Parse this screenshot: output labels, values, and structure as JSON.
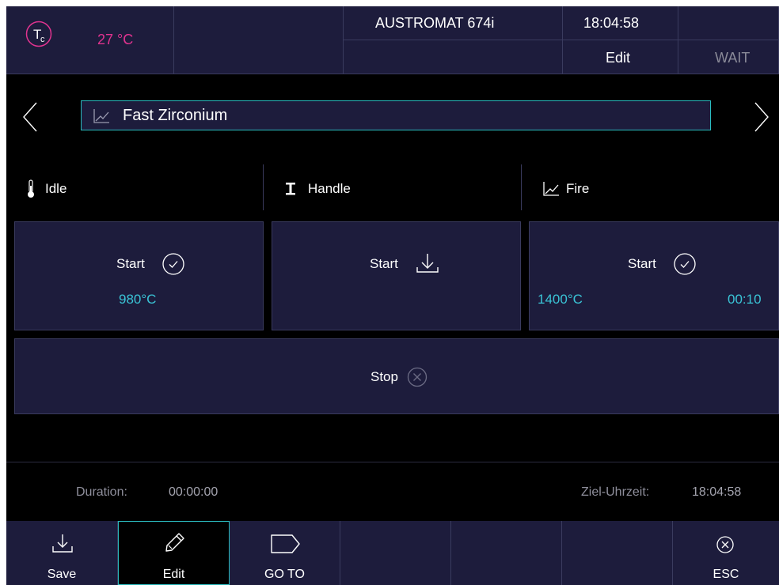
{
  "header": {
    "temp_symbol_main": "T",
    "temp_symbol_sub": "c",
    "temp_value": "27 °C",
    "device_name": "AUSTROMAT 674i",
    "clock": "18:04:58",
    "mode": "Edit",
    "status": "WAIT"
  },
  "program": {
    "name": "Fast Zirconium"
  },
  "phases": {
    "idle_label": "Idle",
    "handle_label": "Handle",
    "fire_label": "Fire"
  },
  "actions": {
    "idle_start_label": "Start",
    "idle_temp": "980°C",
    "handle_start_label": "Start",
    "fire_start_label": "Start",
    "fire_temp": "1400°C",
    "fire_time": "00:10",
    "stop_label": "Stop"
  },
  "info": {
    "duration_label": "Duration:",
    "duration_value": "00:00:00",
    "target_label": "Ziel-Uhrzeit:",
    "target_value": "18:04:58"
  },
  "toolbar": {
    "save_label": "Save",
    "edit_label": "Edit",
    "goto_label": "GO TO",
    "esc_label": "ESC"
  },
  "colors": {
    "panel": "#1d1c3c",
    "accent": "#2bbcc0",
    "temp_magenta": "#e0338f",
    "value_cyan": "#3ac4d6"
  }
}
